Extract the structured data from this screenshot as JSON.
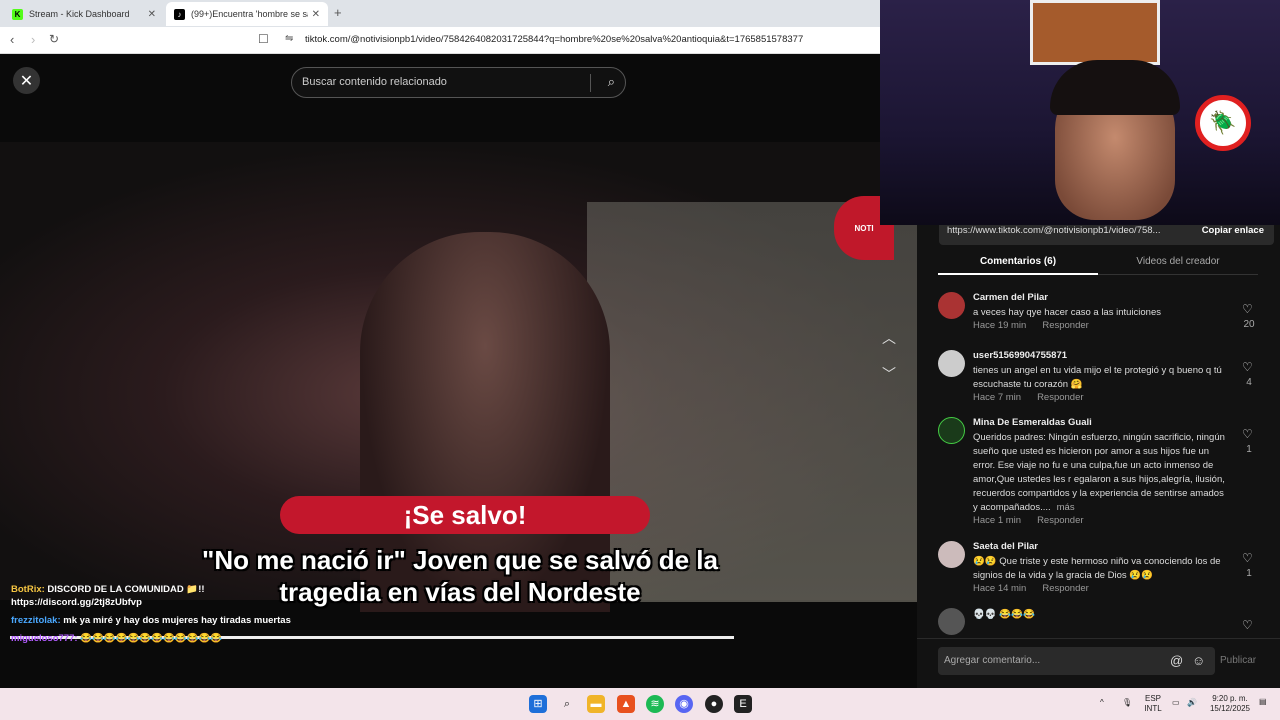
{
  "browser": {
    "tabs": [
      {
        "label": "Stream - Kick Dashboard",
        "favicon": "K"
      },
      {
        "label": "(99+)Encuentra 'hombre se sa",
        "favicon": "♪"
      }
    ],
    "url": "tiktok.com/@notivisionpb1/video/7584264082031725844?q=hombre%20se%20salva%20antioquia&t=1765851578377"
  },
  "video": {
    "search_placeholder": "Buscar contenido relacionado",
    "badge": "¡Se salvo!",
    "headline": "\"No me nació ir\" Joven que se salvó de la tragedia en vías del Nordeste",
    "logo_text": "NOTI"
  },
  "chat": [
    {
      "user": "BotRix:",
      "text": "DISCORD DE LA COMUNIDAD 📁!! https://discord.gg/2tj8zUbfvp"
    },
    {
      "user": "frezzitolak:",
      "text": "mk ya miré y hay dos mujeres hay tiradas muertas"
    },
    {
      "user": "migueloso777:",
      "text": "😂😂😂😂😂😂😂😂😂😂😂😂"
    }
  ],
  "panel": {
    "link": "https://www.tiktok.com/@notivisionpb1/video/758...",
    "copy_label": "Copiar enlace",
    "tab_comments": "Comentarios (6)",
    "tab_creator": "Videos del creador",
    "comments": [
      {
        "name": "Carmen del Pilar",
        "text": "a veces hay qye hacer caso a las intuiciones",
        "time": "Hace 19 min",
        "reply": "Responder",
        "likes": "20"
      },
      {
        "name": "user5156990475587​1",
        "text": "tienes un angel en tu vida mijo el te protegió y q bueno q tú escuchaste tu corazón 🤗",
        "time": "Hace 7 min",
        "reply": "Responder",
        "likes": "4"
      },
      {
        "name": "Mina De Esmeraldas Guali",
        "text": "Queridos padres: Ningún esfuerzo, ningún sacrificio, ningún sueño que usted es hicieron por amor a sus hijos fue un error. Ese viaje no fu e una culpa,fue un acto inmenso de amor,Que ustedes les r egalaron a sus hijos,alegría, ilusión, recuerdos compartidos y la experiencia de sentirse amados y acompañados....",
        "more": "más",
        "time": "Hace 1 min",
        "reply": "Responder",
        "likes": "1"
      },
      {
        "name": "Saeta del Pilar",
        "text": "😢😢 Que triste y este hermoso niño va conociendo los de signios de la vida y la gracia de Dios 😢😢",
        "time": "Hace 14 min",
        "reply": "Responder",
        "likes": "1"
      },
      {
        "name": "",
        "text": "💀💀 😂😂😂",
        "time": "",
        "reply": "",
        "likes": ""
      }
    ],
    "add_placeholder": "Agregar comentario...",
    "publish": "Publicar"
  },
  "taskbar": {
    "lang": "ESP",
    "lang2": "INTL",
    "time": "9:20 p. m.",
    "date": "15/12/2025"
  }
}
